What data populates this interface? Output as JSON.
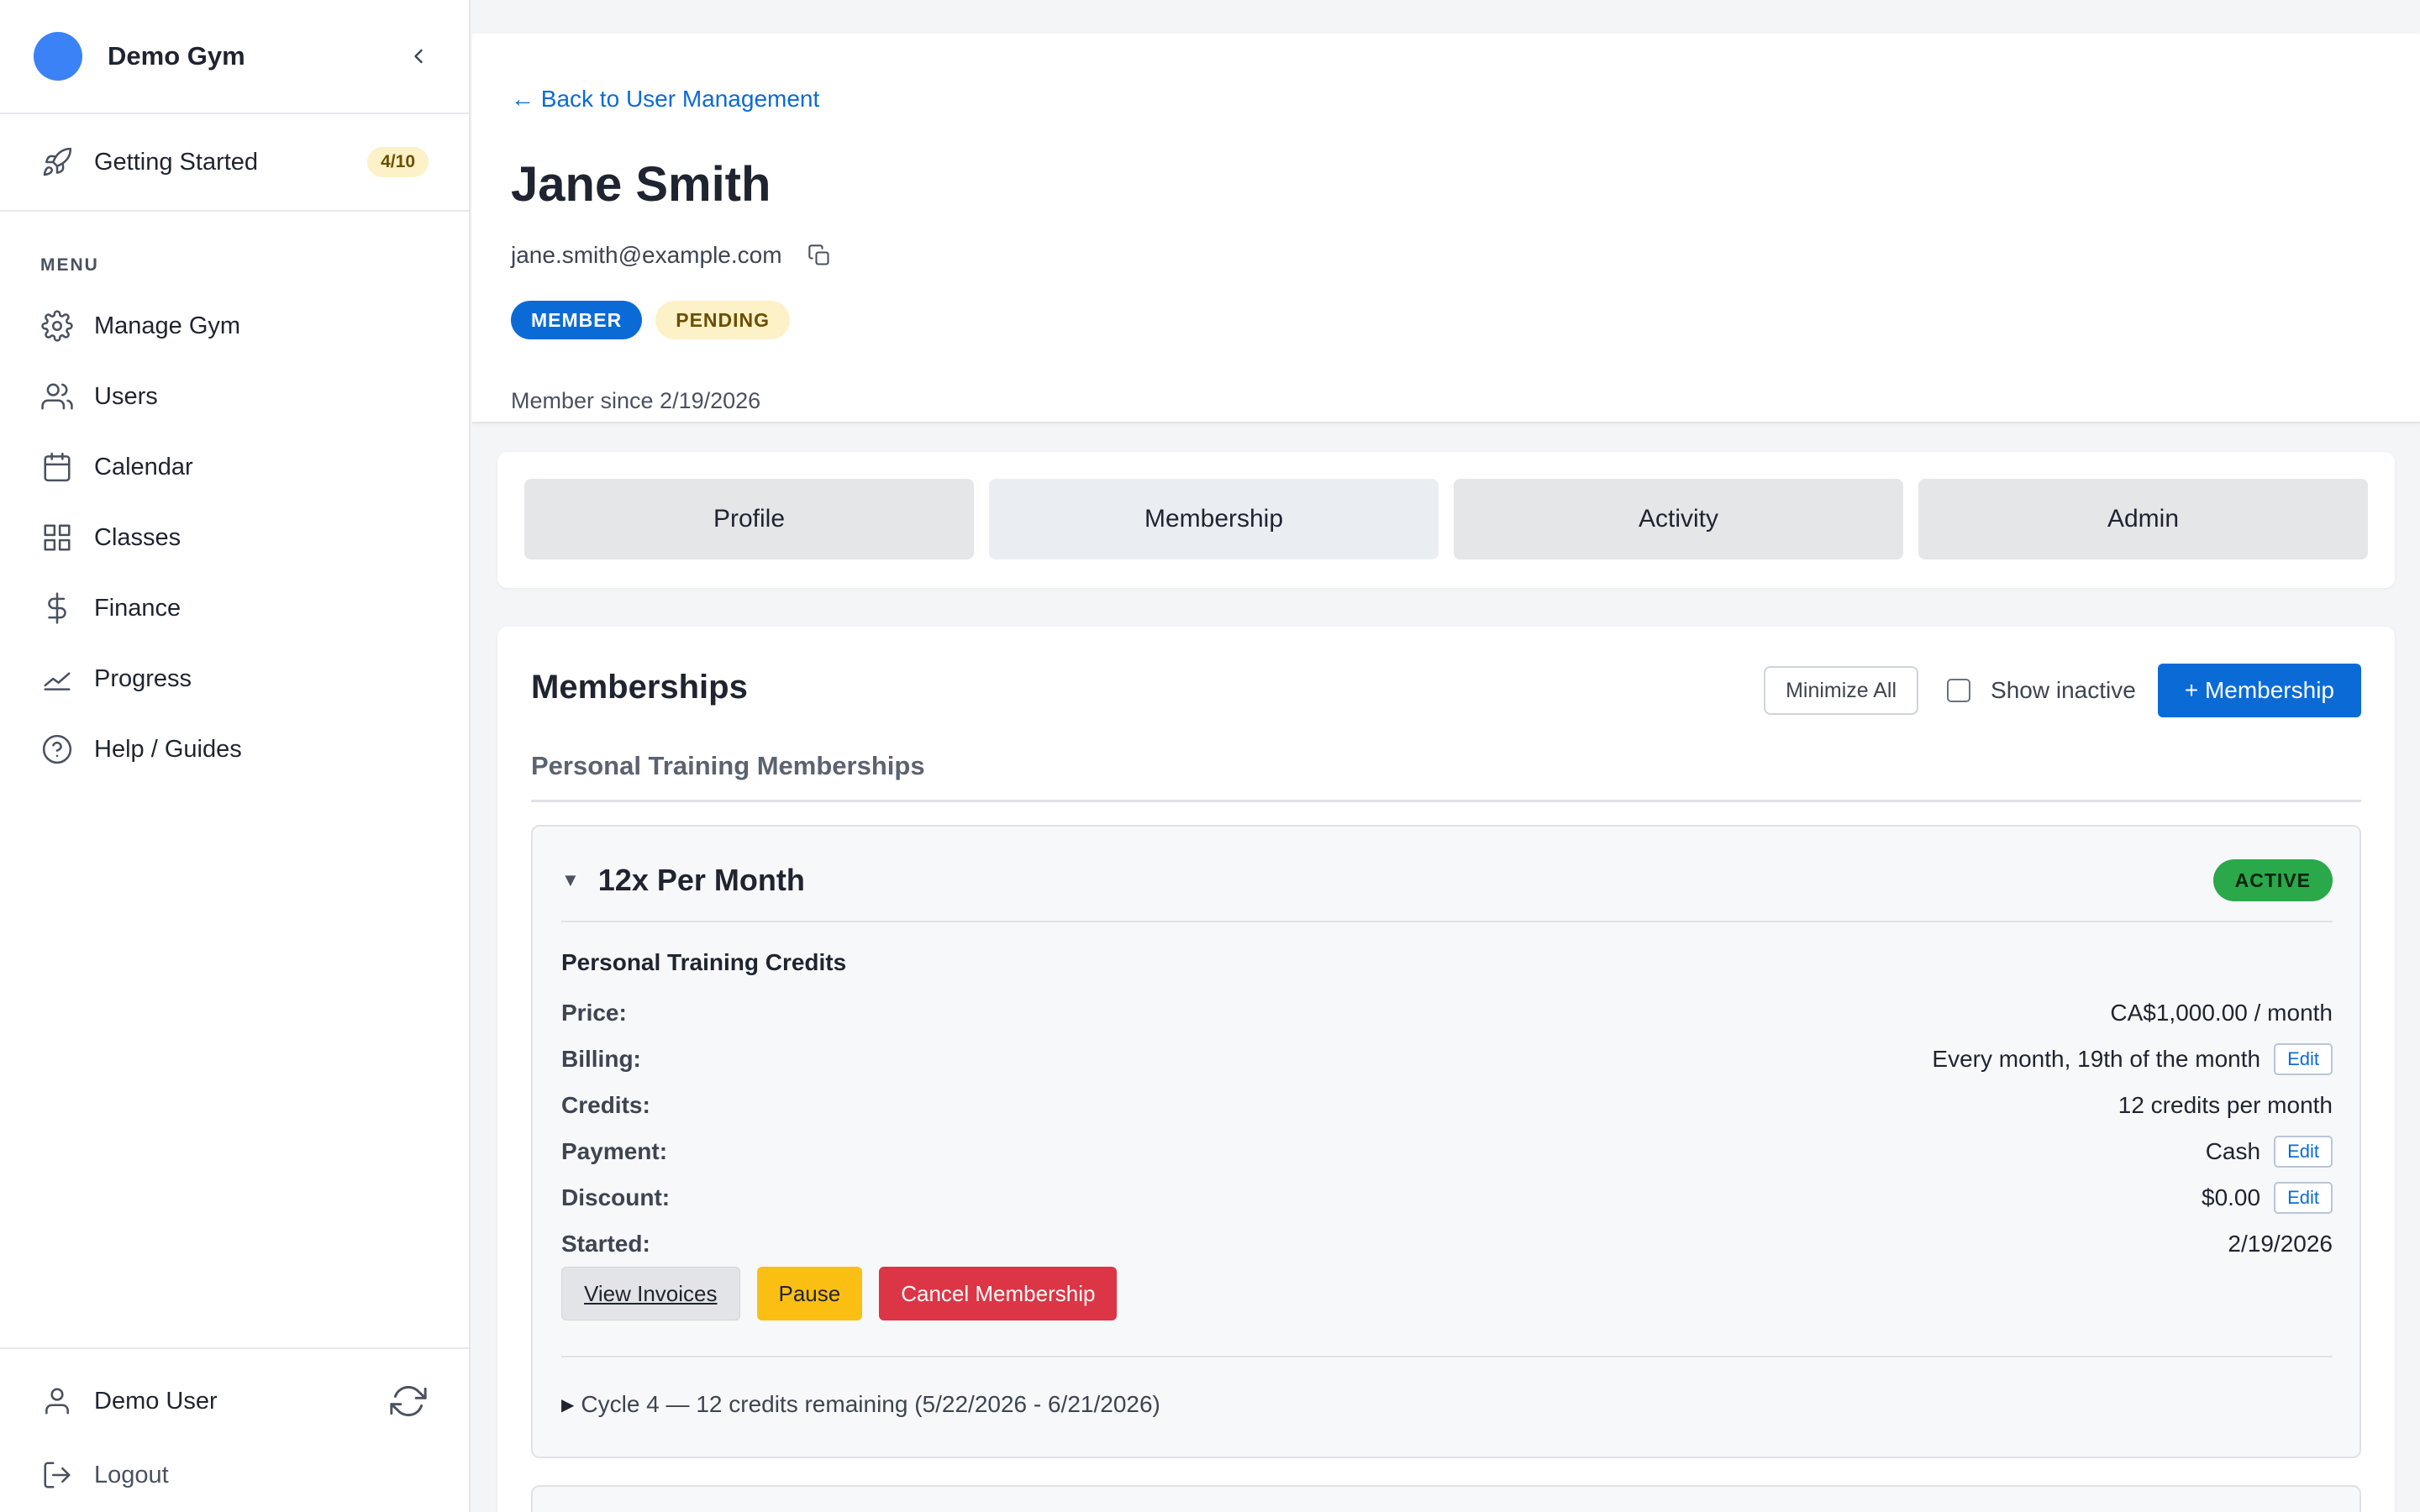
{
  "brand": {
    "name": "Demo Gym",
    "accent": "#3b82f6"
  },
  "getting_started": {
    "label": "Getting Started",
    "badge": "4/10"
  },
  "menu": {
    "heading": "MENU",
    "items": [
      {
        "label": "Manage Gym",
        "icon": "gear-icon"
      },
      {
        "label": "Users",
        "icon": "users-icon"
      },
      {
        "label": "Calendar",
        "icon": "calendar-icon"
      },
      {
        "label": "Classes",
        "icon": "grid-icon"
      },
      {
        "label": "Finance",
        "icon": "dollar-icon"
      },
      {
        "label": "Progress",
        "icon": "chart-line-icon"
      },
      {
        "label": "Help / Guides",
        "icon": "help-icon"
      }
    ]
  },
  "account": {
    "user": "Demo User",
    "logout": "Logout"
  },
  "header": {
    "back_link": "← Back to User Management",
    "name": "Jane Smith",
    "email": "jane.smith@example.com",
    "badges": {
      "role": "MEMBER",
      "status": "PENDING"
    },
    "member_since": "Member since 2/19/2026"
  },
  "tabs": [
    {
      "label": "Profile"
    },
    {
      "label": "Membership",
      "active": true
    },
    {
      "label": "Activity"
    },
    {
      "label": "Admin"
    }
  ],
  "memberships": {
    "title": "Memberships",
    "minimize_all": "Minimize All",
    "show_inactive": "Show inactive",
    "add_button": "+ Membership",
    "section_title": "Personal Training Memberships",
    "plan": {
      "name": "12x Per Month",
      "status": "ACTIVE",
      "subtitle": "Personal Training Credits",
      "rows": [
        {
          "label": "Price:",
          "value": "CA$1,000.00 / month",
          "editable": false
        },
        {
          "label": "Billing:",
          "value": "Every month, 19th of the month",
          "editable": true
        },
        {
          "label": "Credits:",
          "value": "12 credits per month",
          "editable": false
        },
        {
          "label": "Payment:",
          "value": "Cash",
          "editable": true
        },
        {
          "label": "Discount:",
          "value": "$0.00",
          "editable": true
        },
        {
          "label": "Started:",
          "value": "2/19/2026",
          "editable": false
        }
      ],
      "edit_label": "Edit",
      "actions": {
        "view_invoices": "View Invoices",
        "pause": "Pause",
        "cancel": "Cancel Membership"
      },
      "cycle": "Cycle 4 — 12 credits remaining (5/22/2026 - 6/21/2026)"
    }
  },
  "colors": {
    "primary": "#0b6bd6",
    "active": "#2aa84a",
    "warning": "#fbbf14",
    "danger": "#dc3545"
  }
}
